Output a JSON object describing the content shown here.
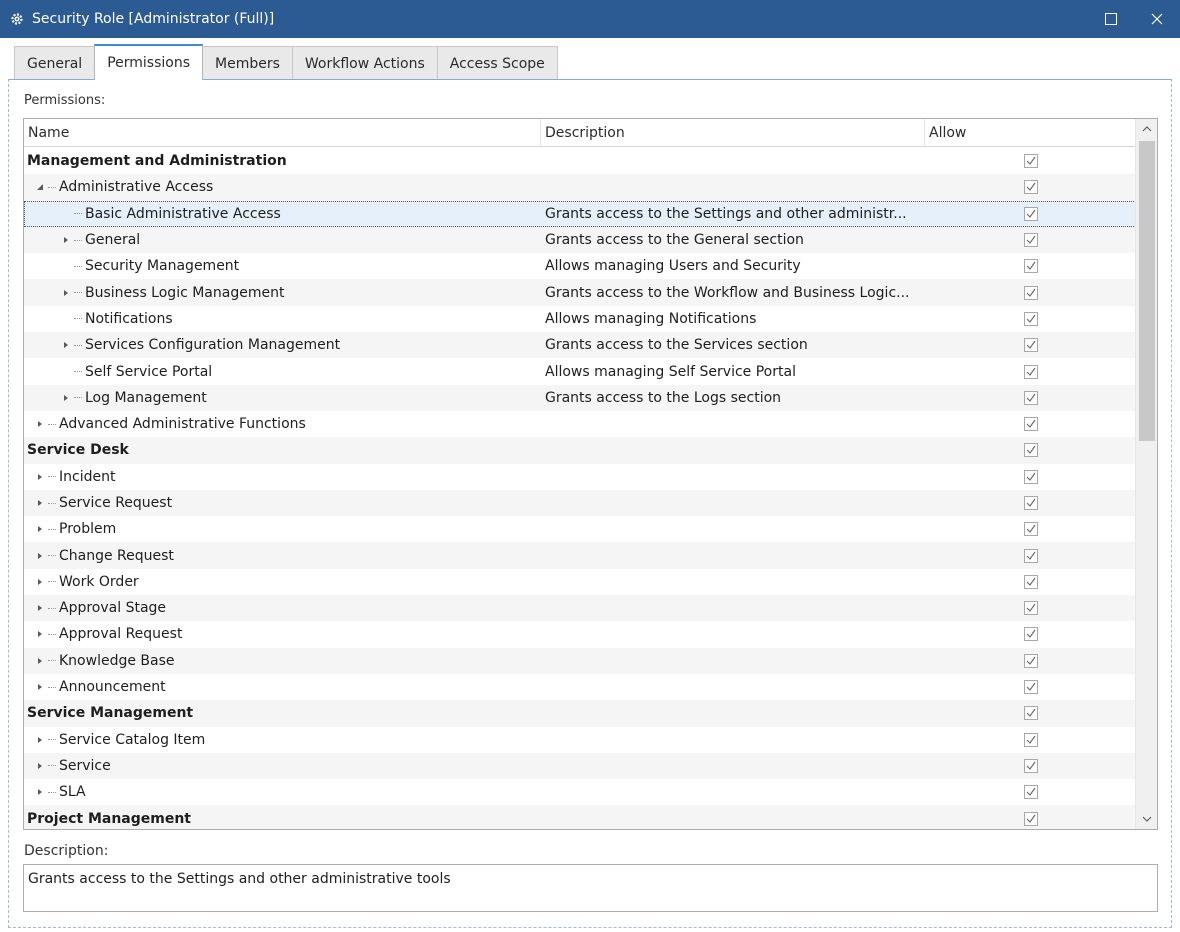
{
  "window": {
    "title": "Security Role [Administrator (Full)]",
    "icon": "gear-icon"
  },
  "tabs": [
    {
      "label": "General",
      "active": false
    },
    {
      "label": "Permissions",
      "active": true
    },
    {
      "label": "Members",
      "active": false
    },
    {
      "label": "Workflow Actions",
      "active": false
    },
    {
      "label": "Access Scope",
      "active": false
    }
  ],
  "permissions_label": "Permissions:",
  "columns": {
    "name": "Name",
    "description": "Description",
    "allow": "Allow"
  },
  "rows": [
    {
      "name": "Management and Administration",
      "description": "",
      "level": 0,
      "bold": true,
      "expander": "none",
      "allow": true
    },
    {
      "name": "Administrative Access",
      "description": "",
      "level": 1,
      "bold": false,
      "expander": "expanded",
      "allow": true
    },
    {
      "name": "Basic Administrative Access",
      "description": "Grants access to the Settings and other administr...",
      "level": 2,
      "bold": false,
      "expander": "none",
      "allow": true,
      "selected": true
    },
    {
      "name": "General",
      "description": "Grants access to the General section",
      "level": 2,
      "bold": false,
      "expander": "collapsed",
      "allow": true
    },
    {
      "name": "Security Management",
      "description": "Allows managing Users and Security",
      "level": 2,
      "bold": false,
      "expander": "none",
      "allow": true
    },
    {
      "name": "Business Logic Management",
      "description": "Grants access to the Workflow and Business Logic...",
      "level": 2,
      "bold": false,
      "expander": "collapsed",
      "allow": true
    },
    {
      "name": "Notifications",
      "description": "Allows managing Notifications",
      "level": 2,
      "bold": false,
      "expander": "none",
      "allow": true
    },
    {
      "name": "Services Configuration Management",
      "description": "Grants access to the Services section",
      "level": 2,
      "bold": false,
      "expander": "collapsed",
      "allow": true
    },
    {
      "name": "Self Service Portal",
      "description": "Allows managing Self Service Portal",
      "level": 2,
      "bold": false,
      "expander": "none",
      "allow": true
    },
    {
      "name": "Log Management",
      "description": "Grants access to the Logs section",
      "level": 2,
      "bold": false,
      "expander": "collapsed",
      "allow": true
    },
    {
      "name": "Advanced Administrative Functions",
      "description": "",
      "level": 1,
      "bold": false,
      "expander": "collapsed",
      "allow": true
    },
    {
      "name": "Service Desk",
      "description": "",
      "level": 0,
      "bold": true,
      "expander": "none",
      "allow": true
    },
    {
      "name": "Incident",
      "description": "",
      "level": 1,
      "bold": false,
      "expander": "collapsed",
      "allow": true
    },
    {
      "name": "Service Request",
      "description": "",
      "level": 1,
      "bold": false,
      "expander": "collapsed",
      "allow": true
    },
    {
      "name": "Problem",
      "description": "",
      "level": 1,
      "bold": false,
      "expander": "collapsed",
      "allow": true
    },
    {
      "name": "Change Request",
      "description": "",
      "level": 1,
      "bold": false,
      "expander": "collapsed",
      "allow": true
    },
    {
      "name": "Work Order",
      "description": "",
      "level": 1,
      "bold": false,
      "expander": "collapsed",
      "allow": true
    },
    {
      "name": "Approval Stage",
      "description": "",
      "level": 1,
      "bold": false,
      "expander": "collapsed",
      "allow": true
    },
    {
      "name": "Approval Request",
      "description": "",
      "level": 1,
      "bold": false,
      "expander": "collapsed",
      "allow": true
    },
    {
      "name": "Knowledge Base",
      "description": "",
      "level": 1,
      "bold": false,
      "expander": "collapsed",
      "allow": true
    },
    {
      "name": "Announcement",
      "description": "",
      "level": 1,
      "bold": false,
      "expander": "collapsed",
      "allow": true
    },
    {
      "name": "Service Management",
      "description": "",
      "level": 0,
      "bold": true,
      "expander": "none",
      "allow": true
    },
    {
      "name": "Service Catalog Item",
      "description": "",
      "level": 1,
      "bold": false,
      "expander": "collapsed",
      "allow": true
    },
    {
      "name": "Service",
      "description": "",
      "level": 1,
      "bold": false,
      "expander": "collapsed",
      "allow": true
    },
    {
      "name": "SLA",
      "description": "",
      "level": 1,
      "bold": false,
      "expander": "collapsed",
      "allow": true
    },
    {
      "name": "Project Management",
      "description": "",
      "level": 0,
      "bold": true,
      "expander": "none",
      "allow": true
    }
  ],
  "description_label": "Description:",
  "description_text": "Grants access to the Settings and other administrative tools"
}
